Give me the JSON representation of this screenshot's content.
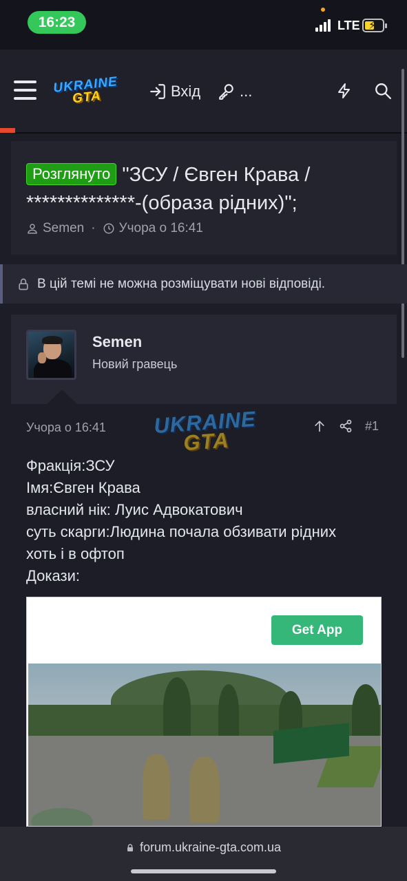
{
  "status_bar": {
    "time": "16:23",
    "network": "LTE",
    "battery_level": 0.45,
    "charging": true
  },
  "nav": {
    "logo_top": "UKRAINE",
    "logo_bottom": "GTA",
    "login_label": "Вхід",
    "register_label": "...",
    "icons": [
      "menu-icon",
      "login-icon",
      "key-icon",
      "bolt-icon",
      "search-icon"
    ]
  },
  "thread": {
    "badge": "Розглянуто",
    "title": "\"ЗСУ / Євген Крава / **************-(образа рідних)\";",
    "author": "Semen",
    "separator": "·",
    "date": "Учора о 16:41"
  },
  "notice": {
    "text": "В цій темі не можна розміщувати нові відповіді."
  },
  "post": {
    "username": "Semen",
    "user_role": "Новий гравець",
    "time": "Учора о 16:41",
    "number": "#1",
    "watermark_top": "UKRAINE",
    "watermark_bottom": "GTA",
    "lines": [
      "Фракція:ЗСУ",
      "Імя:Євген Крава",
      "власний нік: Луис Адвокатович",
      "суть скарги:Людина почала обзивати рідних",
      "хоть і в офтоп",
      "Докази:"
    ]
  },
  "attachment": {
    "button_label": "Get App"
  },
  "browser": {
    "url": "forum.ukraine-gta.com.ua"
  },
  "colors": {
    "background": "#1c1d26",
    "badge_green": "#1f9d14",
    "get_app_green": "#35b77a",
    "time_pill": "#34c759",
    "accent_orange": "#e5492b"
  }
}
